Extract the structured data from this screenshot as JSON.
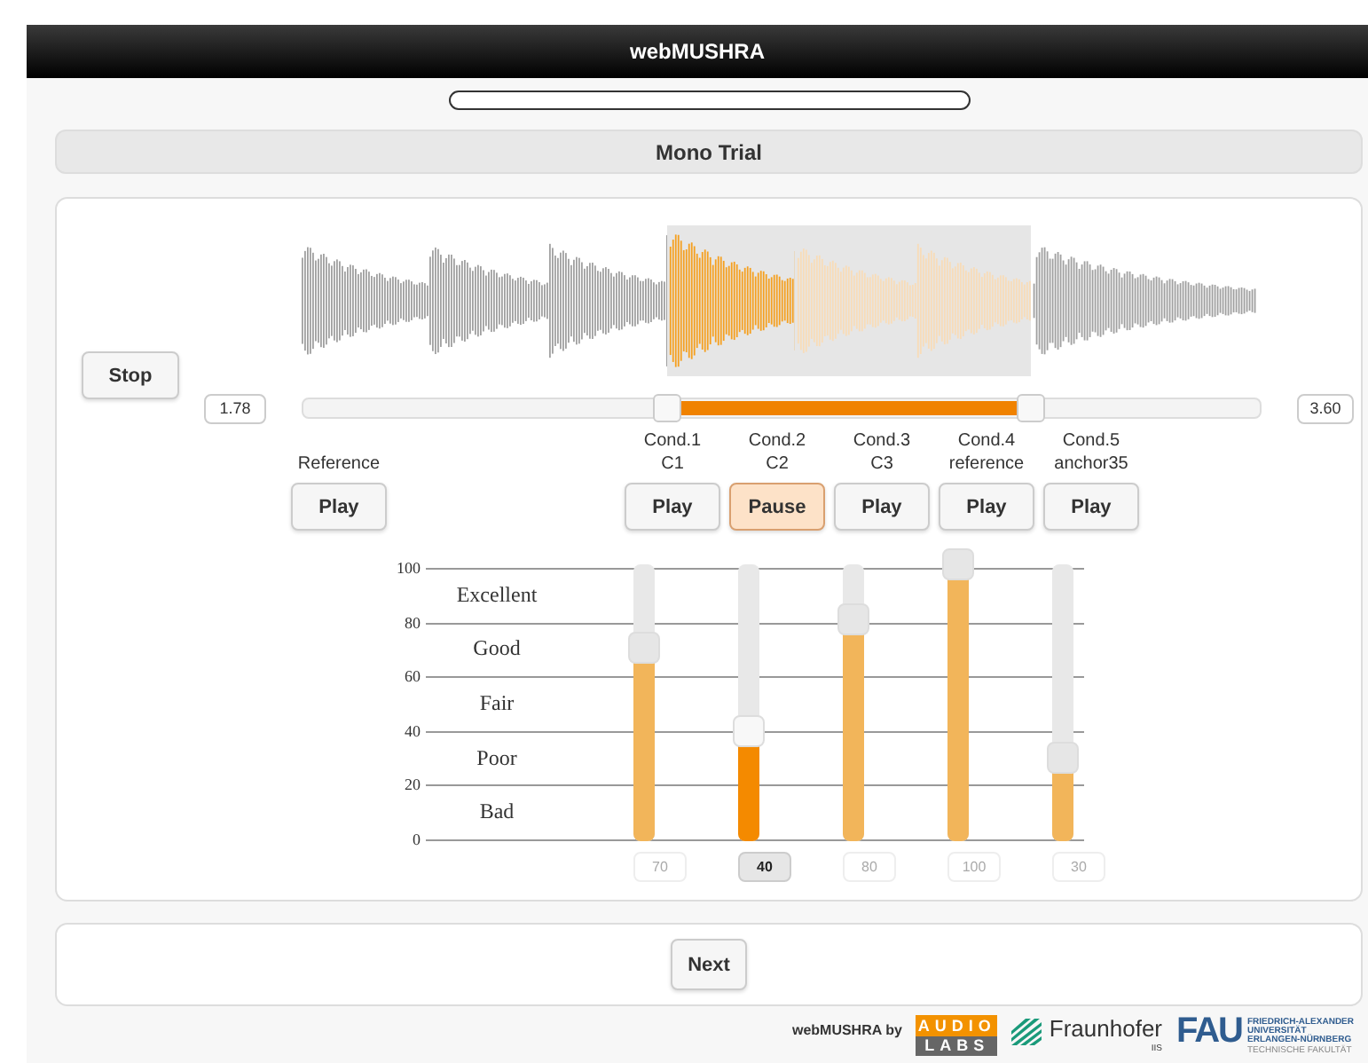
{
  "header": {
    "title": "webMUSHRA"
  },
  "progress": {
    "level": 0
  },
  "trial": {
    "title": "Mono Trial"
  },
  "stop_button": "Stop",
  "loop": {
    "start_value": "1.78",
    "end_value": "3.60",
    "start": {
      "level": 0.38
    },
    "end": {
      "level": 0.76
    }
  },
  "playback": {
    "level": 0.35
  },
  "reference": {
    "label": "Reference",
    "button": "Play",
    "playing": false
  },
  "conditions": [
    {
      "label": [
        "Cond.1",
        "C1"
      ],
      "button": "Play",
      "playing": false,
      "selected": false,
      "level": 0.7,
      "value": "70"
    },
    {
      "label": [
        "Cond.2",
        "C2"
      ],
      "button": "Pause",
      "playing": true,
      "selected": true,
      "level": 0.4,
      "value": "40"
    },
    {
      "label": [
        "Cond.3",
        "C3"
      ],
      "button": "Play",
      "playing": false,
      "selected": false,
      "level": 0.8,
      "value": "80"
    },
    {
      "label": [
        "Cond.4",
        "reference"
      ],
      "button": "Play",
      "playing": false,
      "selected": false,
      "level": 1.0,
      "value": "100"
    },
    {
      "label": [
        "Cond.5",
        "anchor35"
      ],
      "button": "Play",
      "playing": false,
      "selected": false,
      "level": 0.3,
      "value": "30"
    }
  ],
  "scale": {
    "ticks": [
      "100",
      "80",
      "60",
      "40",
      "20",
      "0"
    ],
    "labels": [
      "Excellent",
      "Good",
      "Fair",
      "Poor",
      "Bad"
    ]
  },
  "next_button": "Next",
  "footer": {
    "credit": "webMUSHRA by",
    "audiolabs": [
      "AUDIO",
      "LABS"
    ],
    "fraunhofer": "Fraunhofer",
    "fraunhofer_sub": "IIS",
    "fau": "FAU",
    "fau_lines": [
      "FRIEDRICH-ALEXANDER",
      "UNIVERSITÄT",
      "ERLANGEN-NÜRNBERG"
    ],
    "fau_faculty": "TECHNISCHE FAKULTÄT"
  }
}
